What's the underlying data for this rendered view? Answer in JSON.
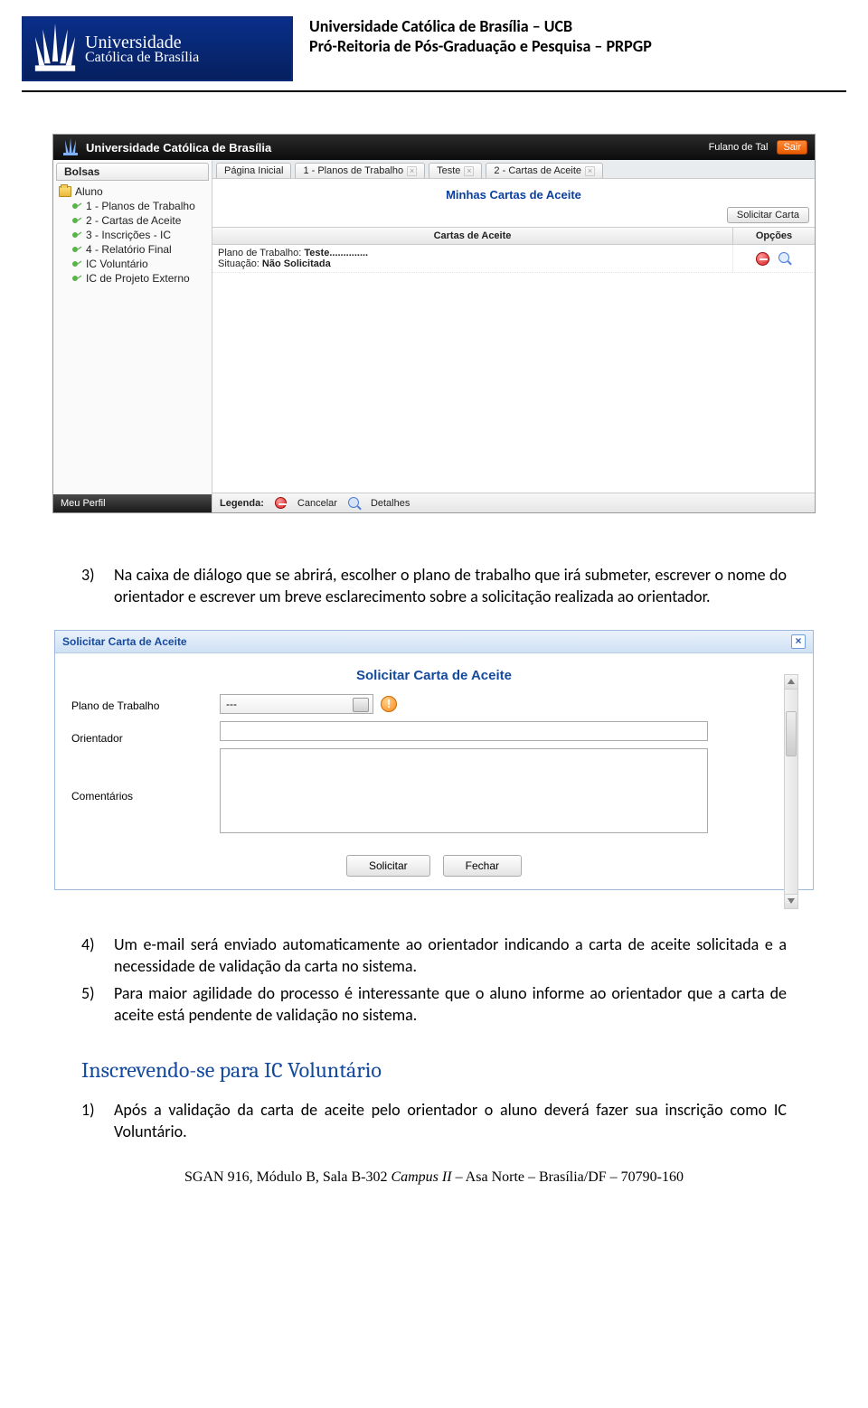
{
  "header": {
    "logo_line1": "Universidade",
    "logo_line2": "Católica de Brasília",
    "title_line1": "Universidade Católica de Brasília – UCB",
    "title_line2": "Pró-Reitoria de Pós-Graduação e Pesquisa – PRPGP"
  },
  "screenshot1": {
    "brand": "Universidade Católica de Brasília",
    "user": "Fulano de Tal",
    "logout": "Sair",
    "sidebar_tab": "Bolsas",
    "tree_root": "Aluno",
    "tree_items": [
      "1 - Planos de Trabalho",
      "2 - Cartas de Aceite",
      "3 - Inscrições - IC",
      "4 - Relatório Final",
      "IC Voluntário",
      "IC de Projeto Externo"
    ],
    "sidebar_footer": "Meu Perfil",
    "tabs": [
      {
        "label": "Página Inicial",
        "closeable": false
      },
      {
        "label": "1 - Planos de Trabalho",
        "closeable": true
      },
      {
        "label": "Teste",
        "closeable": true
      },
      {
        "label": "2 - Cartas de Aceite",
        "closeable": true
      }
    ],
    "panel_title": "Minhas Cartas de Aceite",
    "solicit_btn": "Solicitar Carta",
    "grid_header_main": "Cartas de Aceite",
    "grid_header_opts": "Opções",
    "row1_line1a": "Plano de Trabalho: ",
    "row1_line1b": "Teste..............",
    "row1_line2a": "Situação: ",
    "row1_line2b": "Não Solicitada",
    "legend_label": "Legenda:",
    "legend_cancel": "Cancelar",
    "legend_details": "Detalhes"
  },
  "body1": {
    "n3": "3)",
    "p3": "Na caixa de diálogo que se abrirá, escolher o plano de trabalho que irá submeter, escrever o nome do orientador e escrever um breve esclarecimento sobre a solicitação realizada ao orientador."
  },
  "dialog": {
    "title": "Solicitar Carta de Aceite",
    "subtitle": "Solicitar Carta de Aceite",
    "label_plano": "Plano de Trabalho",
    "label_orientador": "Orientador",
    "label_coment": "Comentários",
    "select_value": "---",
    "btn_solicitar": "Solicitar",
    "btn_fechar": "Fechar"
  },
  "body2": {
    "n4": "4)",
    "p4": "Um e-mail será enviado automaticamente ao orientador indicando a carta de aceite solicitada e a necessidade de validação da carta no sistema.",
    "n5": "5)",
    "p5": "Para maior agilidade do processo é interessante que o aluno informe ao orientador que a carta de aceite está pendente de validação no sistema."
  },
  "heading": "Inscrevendo-se para IC Voluntário",
  "body3": {
    "n1": "1)",
    "p1": "Após a validação da carta de aceite pelo orientador o aluno deverá fazer sua inscrição como IC Voluntário."
  },
  "footer": {
    "a": "SGAN 916, Módulo B, Sala B-302 ",
    "b": "Campus II",
    "c": " – Asa Norte – Brasília/DF – 70790-160"
  }
}
